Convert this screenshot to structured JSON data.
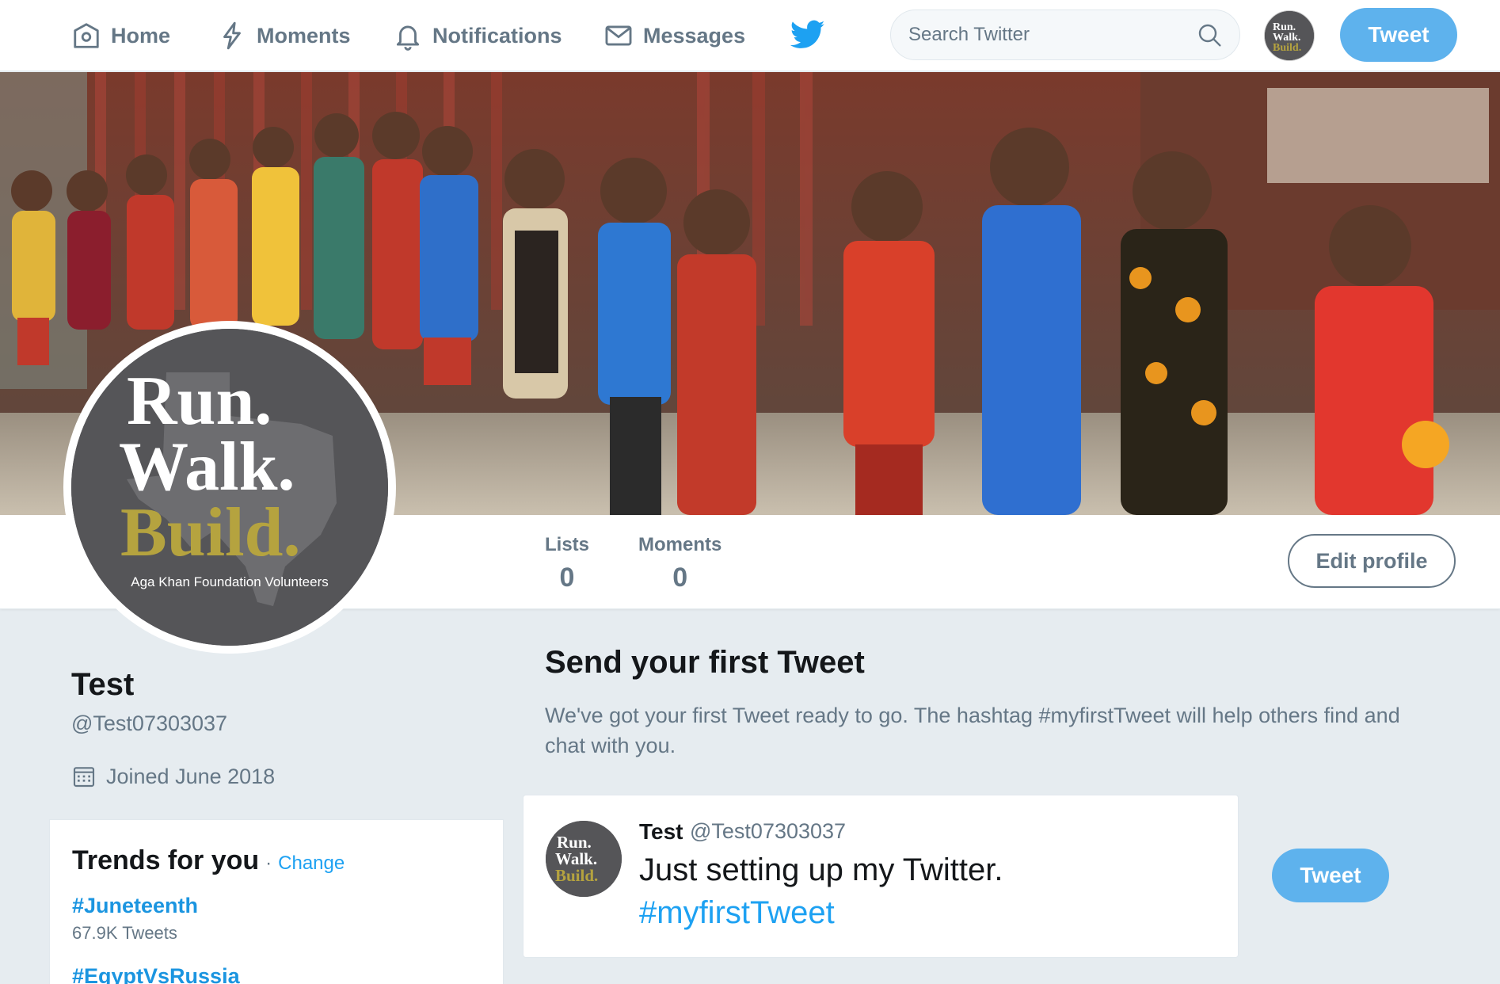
{
  "nav": {
    "home": "Home",
    "moments": "Moments",
    "notifications": "Notifications",
    "messages": "Messages",
    "search_placeholder": "Search Twitter",
    "tweet_button": "Tweet"
  },
  "logo": {
    "line1": "Run.",
    "line2": "Walk.",
    "line3": "Build.",
    "caption": "Aga Khan Foundation Volunteers"
  },
  "profile": {
    "name": "Test",
    "handle": "@Test07303037",
    "joined": "Joined June 2018",
    "stats": [
      {
        "label": "Lists",
        "value": "0"
      },
      {
        "label": "Moments",
        "value": "0"
      }
    ],
    "edit_button": "Edit profile"
  },
  "trends": {
    "title": "Trends for you",
    "separator": "·",
    "change_link": "Change",
    "items": [
      {
        "tag": "#Juneteenth",
        "count": "67.9K Tweets"
      },
      {
        "tag": "#EgyptVsRussia",
        "count": ""
      }
    ]
  },
  "first_tweet": {
    "title": "Send your first Tweet",
    "description": "We've got your first Tweet ready to go. The hashtag #myfirstTweet will help others find and chat with you.",
    "author_name": "Test",
    "author_handle": "@Test07303037",
    "text": "Just setting up my Twitter.",
    "hashtag": "#myfirstTweet",
    "tweet_button": "Tweet"
  },
  "colors": {
    "accent": "#1da1f2",
    "button": "#5eb2ed",
    "muted": "#657786",
    "background": "#e6ecf0",
    "logo_gold": "#b5a33f"
  }
}
